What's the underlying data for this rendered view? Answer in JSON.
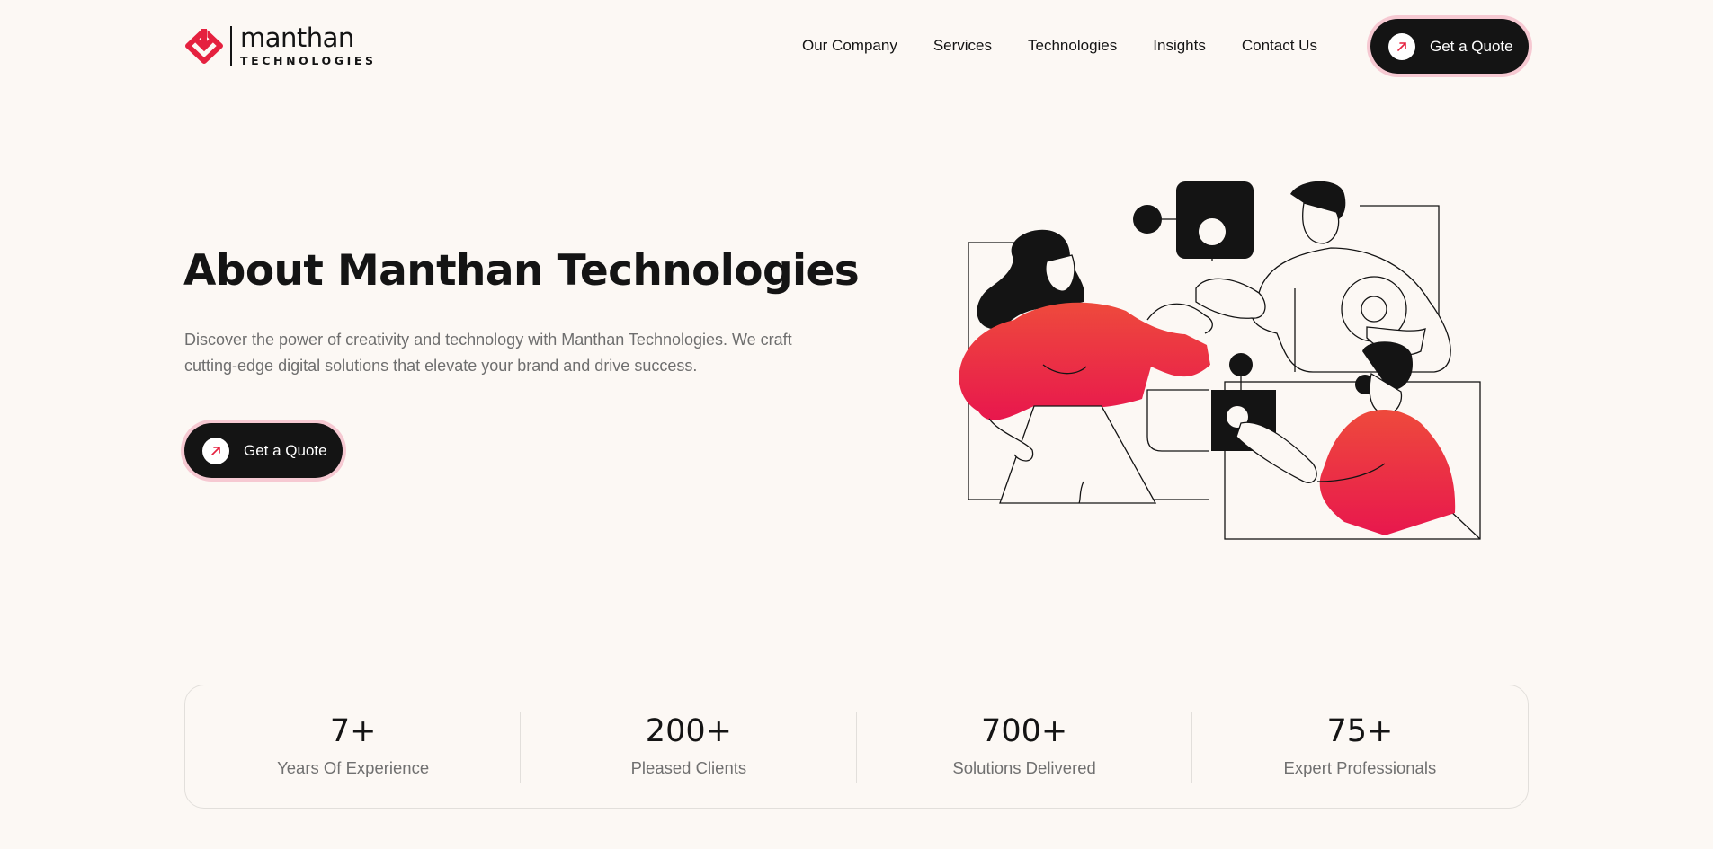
{
  "brand": {
    "name": "manthan",
    "tagline": "TECHNOLOGIES",
    "accent_color": "#e5213f",
    "dark_color": "#141414",
    "background_color": "#fcf8f4"
  },
  "nav": {
    "items": [
      {
        "label": "Our Company"
      },
      {
        "label": "Services"
      },
      {
        "label": "Technologies"
      },
      {
        "label": "Insights"
      },
      {
        "label": "Contact Us"
      }
    ],
    "cta_label": "Get a Quote",
    "cta_icon": "arrow-up-right-icon"
  },
  "hero": {
    "title": "About Manthan Technologies",
    "description": "Discover the power of creativity and technology with Manthan Technologies. We craft cutting-edge digital solutions that elevate your brand and drive success.",
    "cta_label": "Get a Quote",
    "illustration": "team-collaboration-puzzle-illustration"
  },
  "stats": [
    {
      "value": "7+",
      "label": "Years Of Experience"
    },
    {
      "value": "200+",
      "label": "Pleased Clients"
    },
    {
      "value": "700+",
      "label": "Solutions Delivered"
    },
    {
      "value": "75+",
      "label": "Expert Professionals"
    }
  ]
}
